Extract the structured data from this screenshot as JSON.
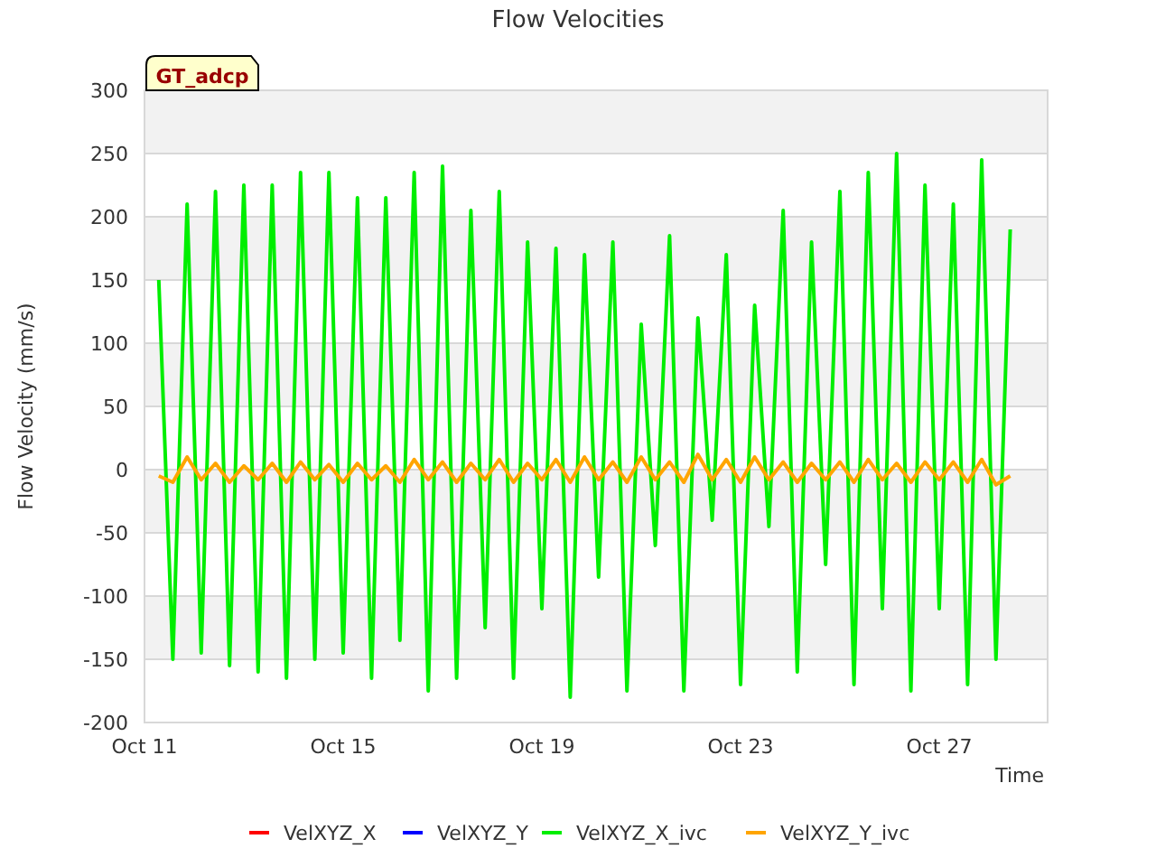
{
  "chart": {
    "badge": "GT_adcp",
    "chart_data": {
      "type": "line",
      "title": "Flow Velocities",
      "xlabel": "Time",
      "ylabel": "Flow Velocity (mm/s)",
      "categories": [
        "Oct 11",
        null,
        null,
        null,
        null,
        null,
        null,
        null,
        null,
        null,
        null,
        null,
        null,
        null,
        "Oct 15",
        null,
        null,
        null,
        null,
        null,
        null,
        null,
        null,
        null,
        null,
        null,
        null,
        null,
        "Oct 19",
        null,
        null,
        null,
        null,
        null,
        null,
        null,
        null,
        null,
        null,
        null,
        null,
        null,
        "Oct 23",
        null,
        null,
        null,
        null,
        null,
        null,
        null,
        null,
        null,
        null,
        null,
        null,
        null,
        "Oct 27",
        null,
        null,
        null,
        null,
        null
      ],
      "series": [
        {
          "name": "VelXYZ_X",
          "color": "#ff0000",
          "values": [
            null,
            null,
            null,
            null,
            null,
            null,
            null,
            null,
            null,
            null,
            null,
            null,
            null,
            null,
            null,
            null,
            null,
            null,
            null,
            null,
            null,
            null,
            null,
            null,
            null,
            null,
            null,
            null,
            null,
            null,
            null,
            null,
            null,
            null,
            null,
            null,
            null,
            null,
            null,
            null,
            null,
            null,
            null,
            null,
            null,
            null,
            null,
            null,
            null,
            null,
            null,
            null,
            null,
            null,
            null,
            null,
            null,
            null,
            null,
            null,
            null,
            null
          ]
        },
        {
          "name": "VelXYZ_Y",
          "color": "#0000ff",
          "values": [
            null,
            null,
            null,
            null,
            null,
            null,
            null,
            null,
            null,
            null,
            null,
            null,
            null,
            null,
            null,
            null,
            null,
            null,
            null,
            null,
            null,
            null,
            null,
            null,
            null,
            null,
            null,
            null,
            null,
            null,
            null,
            null,
            null,
            null,
            null,
            null,
            null,
            null,
            null,
            null,
            null,
            null,
            null,
            null,
            null,
            null,
            null,
            null,
            null,
            null,
            null,
            null,
            null,
            null,
            null,
            null,
            null,
            null,
            null,
            null,
            null,
            null
          ]
        },
        {
          "name": "VelXYZ_X_ivc",
          "color": "#00ee00",
          "values": [
            null,
            150,
            -150,
            210,
            -145,
            220,
            -155,
            225,
            -160,
            225,
            -165,
            235,
            -150,
            235,
            -145,
            215,
            -165,
            215,
            -135,
            235,
            -175,
            240,
            -165,
            205,
            -125,
            220,
            -165,
            180,
            -110,
            175,
            -180,
            170,
            -85,
            180,
            -175,
            115,
            -60,
            185,
            -175,
            120,
            -40,
            170,
            -170,
            130,
            -45,
            205,
            -160,
            180,
            -75,
            220,
            -170,
            235,
            -110,
            250,
            -175,
            225,
            -110,
            210,
            -170,
            245,
            -150,
            190
          ]
        },
        {
          "name": "VelXYZ_Y_ivc",
          "color": "#ffa500",
          "values": [
            null,
            -5,
            -10,
            10,
            -8,
            5,
            -10,
            3,
            -8,
            5,
            -10,
            6,
            -8,
            4,
            -10,
            5,
            -8,
            3,
            -10,
            8,
            -8,
            6,
            -10,
            5,
            -8,
            8,
            -10,
            5,
            -8,
            8,
            -10,
            10,
            -8,
            6,
            -10,
            10,
            -8,
            6,
            -10,
            12,
            -8,
            8,
            -10,
            10,
            -8,
            6,
            -10,
            5,
            -8,
            6,
            -10,
            8,
            -8,
            5,
            -10,
            6,
            -8,
            6,
            -10,
            8,
            -12,
            -5
          ]
        }
      ],
      "grid": true,
      "legend": "bottom",
      "ylim": [
        -200,
        300
      ],
      "yticks": [
        -200,
        -150,
        -100,
        -50,
        0,
        50,
        100,
        150,
        200,
        250,
        300
      ]
    }
  }
}
